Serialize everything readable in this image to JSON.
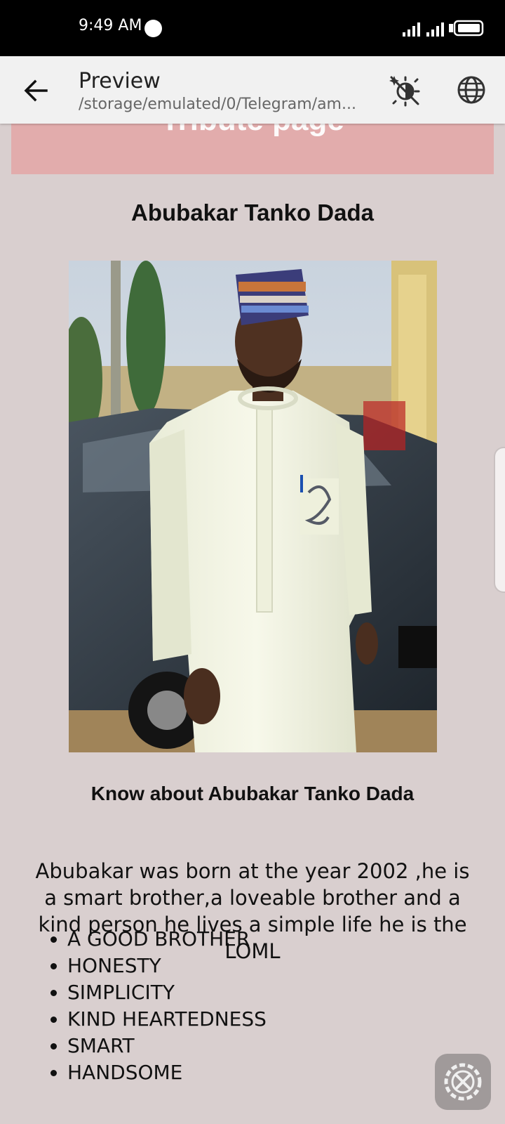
{
  "status_bar": {
    "time": "9:49 AM"
  },
  "app_bar": {
    "title": "Preview",
    "subtitle": "/storage/emulated/0/Telegram/am...",
    "icons": [
      "back-arrow-icon",
      "theme-toggle-icon",
      "globe-icon"
    ]
  },
  "page": {
    "header_title": "Tribute page",
    "name": "Abubakar Tanko Dada",
    "photo_alt": "Photo of Abubakar Tanko Dada",
    "about_heading": "Know about Abubakar Tanko Dada",
    "bio": "Abubakar was born at the year 2002 ,he is a smart brother,a loveable brother and a kind person he lives a simple life he is the LOML",
    "traits": [
      "A GOOD BROTHER",
      "HONESTY",
      "SIMPLICITY",
      "KIND HEARTEDNESS",
      "SMART",
      "HANDSOME"
    ]
  },
  "colors": {
    "page_background": "#d9cfcf",
    "header_banner": "#e2acac",
    "app_bar": "#f1f1f1"
  },
  "fab": {
    "icon": "settings-tools-icon"
  }
}
